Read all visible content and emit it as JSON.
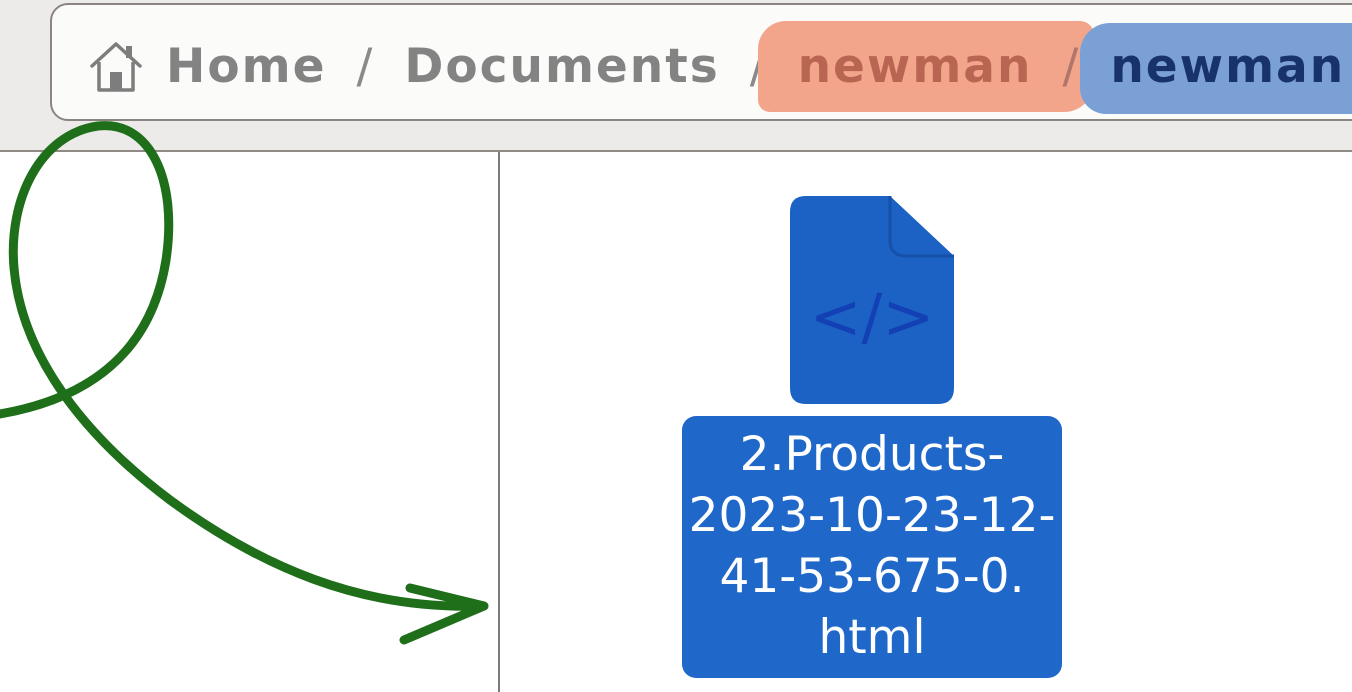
{
  "pathbar": {
    "home_icon": "home-icon",
    "home_label": "Home",
    "separator": "/",
    "documents_label": "Documents",
    "parent_label": "newman",
    "current_label": "newman"
  },
  "file": {
    "icon": "html-file-icon",
    "icon_glyph": "</>",
    "name_lines": [
      "2.Products-",
      "2023-10-23-12-",
      "41-53-675-0.",
      "html"
    ],
    "selected": true
  },
  "annotation": {
    "arrow_color": "#1e6e1a",
    "highlight_orange": "#f3a58b",
    "highlight_blue": "#7aa0d6"
  },
  "colors": {
    "selection": "#1f68c9",
    "icon_fill": "#1b62c4"
  }
}
